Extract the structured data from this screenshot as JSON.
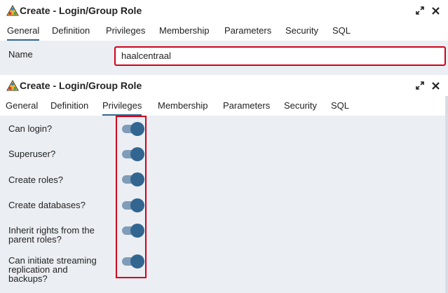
{
  "window_top": {
    "title": "Create - Login/Group Role",
    "tabs": [
      "General",
      "Definition",
      "Privileges",
      "Membership",
      "Parameters",
      "Security",
      "SQL"
    ],
    "active_tab": "General",
    "name_label": "Name",
    "name_value": "haalcentraal"
  },
  "window_bottom": {
    "title": "Create - Login/Group Role",
    "tabs": [
      "General",
      "Definition",
      "Privileges",
      "Membership",
      "Parameters",
      "Security",
      "SQL"
    ],
    "active_tab": "Privileges",
    "privileges": [
      {
        "label": "Can login?",
        "enabled": true
      },
      {
        "label": "Superuser?",
        "enabled": true
      },
      {
        "label": "Create roles?",
        "enabled": true
      },
      {
        "label": "Create databases?",
        "enabled": true
      },
      {
        "label": "Inherit rights from the parent roles?",
        "enabled": true
      },
      {
        "label": "Can initiate streaming replication and backups?",
        "enabled": true
      }
    ]
  },
  "icons": {
    "app": "pgadmin-role-icon",
    "maximize": "maximize-icon",
    "close": "close-icon"
  },
  "colors": {
    "accent": "#326690",
    "toggle_track": "#7f9cb8",
    "highlight": "#d0021b",
    "body_bg": "#ebeef3"
  }
}
